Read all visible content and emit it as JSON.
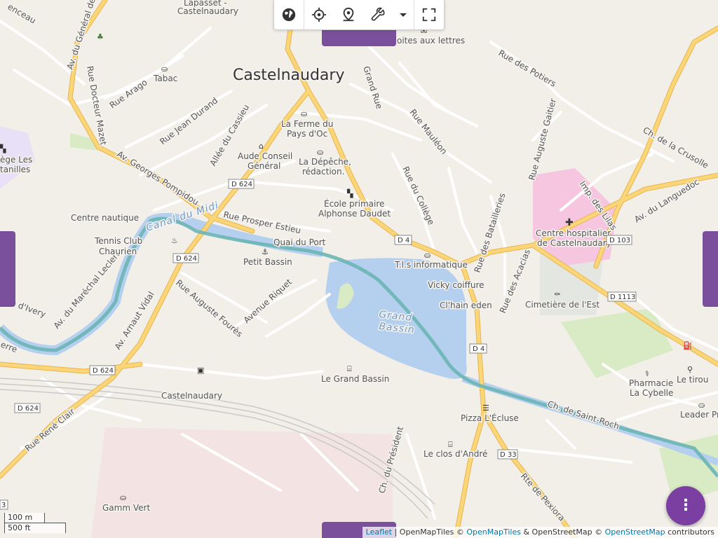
{
  "map": {
    "city": "Castelnaudary",
    "water_label_1": "Grand",
    "water_label_2": "Bassin",
    "canal_label": "Canal du Midi",
    "streets": {
      "av_general": "Av. du Général de",
      "rue_docteur": "Rue Docteur Mazet",
      "rue_arago": "Rue Arago",
      "rue_jean_durand": "Rue Jean Durand",
      "allee_cassieu": "Allée du Cassieu",
      "av_georges": "Av. Georges Pompidou",
      "grand_rue": "Grand Rue",
      "rue_mauleon": "Rue Mauléon",
      "rue_college": "Rue du Collège",
      "rue_potiers": "Rue des Potiers",
      "rue_gaitier": "Rue Auguste Gaitier",
      "ch_crusolle": "Ch. de la Crusolle",
      "imp_lilas": "Imp. des Lilas",
      "av_languedoc": "Av. du Languedoc",
      "rue_prosper": "Rue Prosper Estieu",
      "quai_port": "Quai du Port",
      "rue_batailleries": "Rue des Batailleries",
      "rue_acacias": "Rue des Acacias",
      "av_marechal": "Av. du Maréchal Leclerc",
      "rue_foures": "Rue Auguste Fourès",
      "av_riquet": "Avenue Riquet",
      "av_arnaut": "Av. Arnaut Vidal",
      "ch_saint_roch": "Ch. de Saint-Roch",
      "rue_rene_clair": "Rue René Clair",
      "ch_president": "Ch. du Président",
      "rte_pexiora": "Rte de Pexiora",
      "rue_ery": "Rue d'Ivery",
      "lapasset": "Lapasset -",
      "lapasset2": "Castelnaudary",
      "ceneau": "enceau",
      "rue_erre": "erre",
      "station": "Castelnaudary"
    },
    "shields": {
      "d624a": "D 624",
      "d624b": "D 624",
      "d624c": "D 624",
      "d624d": "D 624",
      "d4a": "D 4",
      "d4b": "D 4",
      "d103": "D 103",
      "d1113": "D 1113",
      "d33": "D 33",
      "d3": "3"
    },
    "pois": {
      "tabac": "Tabac",
      "boites": "oites aux lettres",
      "ferme1": "La Ferme du",
      "ferme2": "Pays d'Oc",
      "conseil1": "Aude Conseil",
      "conseil2": "Général",
      "depeche1": "La Dépêche,",
      "depeche2": "rédaction.",
      "ecole1": "École primaire",
      "ecole2": "Alphonse Daudet",
      "college1": "ège Les",
      "college2": "tanilles",
      "centre_nautique": "Centre nautique",
      "tennis1": "Tennis Club",
      "tennis2": "Chaurien",
      "petit_bassin": "Petit Bassin",
      "tis": "T.l.s informatique",
      "vicky": "Vicky coiffure",
      "clhain": "Cl'hain eden",
      "hospital1": "Centre hospitalier",
      "hospital2": "de Castelnaudary",
      "cimetiere": "Cimetière de l'Est",
      "le_grand_bassin": "Le Grand Bassin",
      "pharmacie1": "Pharmacie",
      "pharmacie2": "La Cybelle",
      "le_tirou": "Le tirou",
      "leader": "Leader Pri",
      "pizza": "Pizza L'Écluse",
      "clos": "Le clos d'André",
      "gamm": "Gamm Vert"
    }
  },
  "toolbar": {
    "items": [
      "globe-icon",
      "locate-icon",
      "place-marker-icon",
      "wrench-icon",
      "caret-down-icon",
      "fullscreen-icon"
    ]
  },
  "fab": {
    "label": "⋮"
  },
  "scale": {
    "metric": "100 m",
    "imperial": "500 ft"
  },
  "attribution": {
    "leaflet": "Leaflet",
    "sep1": " | OpenMapTiles © ",
    "openmaptiles": "OpenMapTiles",
    "sep2": " & OpenStreetMap © ",
    "osm": "OpenStreetMap",
    "sep3": " contributors"
  },
  "colors": {
    "accent": "#7a4f9b",
    "water": "#b5d0ee",
    "canal": "#6ab5b5",
    "major_road": "#fbd679",
    "hospital": "#f6c6e0",
    "park": "#d8ebc4"
  }
}
